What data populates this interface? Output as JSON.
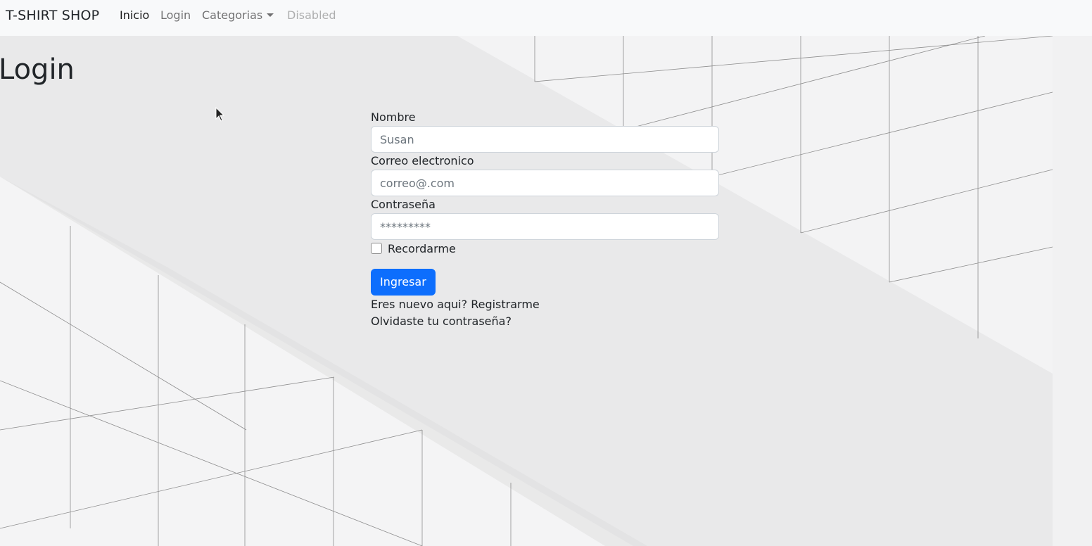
{
  "navbar": {
    "brand": "T-SHIRT SHOP",
    "links": [
      {
        "label": "Inicio",
        "state": "active"
      },
      {
        "label": "Login",
        "state": "normal"
      },
      {
        "label": "Categorias",
        "state": "dropdown"
      },
      {
        "label": "Disabled",
        "state": "disabled"
      }
    ]
  },
  "page": {
    "title": "Login"
  },
  "form": {
    "name_label": "Nombre",
    "name_placeholder": "Susan",
    "email_label": "Correo electronico",
    "email_placeholder": "correo@.com",
    "password_label": "Contraseña",
    "password_placeholder": "*********",
    "remember_label": "Recordarme",
    "remember_checked": false,
    "submit_label": "Ingresar",
    "register_prompt": "Eres nuevo aqui?",
    "register_link": "Registrarme",
    "forgot_link": "Olvidaste tu contraseña?"
  },
  "colors": {
    "primary": "#0d6efd",
    "navbar_bg": "#f8f9fa",
    "page_bg": "#e9e9ea"
  }
}
